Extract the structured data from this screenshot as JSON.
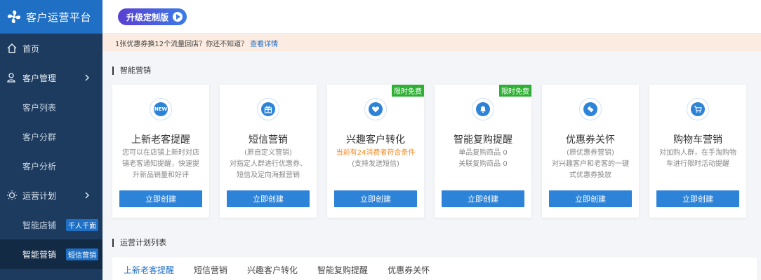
{
  "brand": {
    "title": "客户运营平台",
    "icon": "pinwheel-icon"
  },
  "sidebar": {
    "items": [
      {
        "label": "首页",
        "icon": "home-icon",
        "type": "top"
      },
      {
        "label": "客户管理",
        "icon": "user-icon",
        "type": "top",
        "chevron": true
      },
      {
        "label": "客户列表",
        "type": "sub"
      },
      {
        "label": "客户分群",
        "type": "sub"
      },
      {
        "label": "客户分析",
        "type": "sub"
      },
      {
        "label": "运营计划",
        "icon": "bulb-icon",
        "type": "top",
        "chevron": true
      },
      {
        "label": "智能店铺",
        "type": "sub",
        "tag": "千人千面"
      },
      {
        "label": "智能营销",
        "type": "sub",
        "tag": "短信营销",
        "active": true
      }
    ]
  },
  "topbar": {
    "upgrade_label": "升级定制版"
  },
  "notice": {
    "text": "1张优惠券换12个流量回店？你还不知道？",
    "link": "查看详情"
  },
  "sections": {
    "smart_marketing": "智能营销",
    "plan_list": "运营计划列表"
  },
  "cards": [
    {
      "title": "上新老客提醒",
      "icon": "new-icon",
      "icon_text": "NEW",
      "desc": [
        "您可以在店铺上新时对店",
        "铺老客通知提醒，快速提",
        "升新品销量和好评"
      ],
      "button": "立即创建"
    },
    {
      "title": "短信营销",
      "icon": "gift-icon",
      "desc": [
        "(原自定义营销)",
        "对指定人群进行优惠券、",
        "短信及定向海报营销"
      ],
      "button": "立即创建"
    },
    {
      "title": "兴趣客户转化",
      "icon": "heart-icon",
      "badge": "限时免费",
      "highlight": "当前有24消费者符合条件",
      "desc": [
        "(支持发送短信)"
      ],
      "button": "立即创建"
    },
    {
      "title": "智能复购提醒",
      "icon": "bell-icon",
      "badge": "限时免费",
      "desc": [
        "单品复购商品 0",
        "关联复购商品 0"
      ],
      "button": "立即创建"
    },
    {
      "title": "优惠券关怀",
      "icon": "ticket-icon",
      "desc": [
        "(原优惠券营销)",
        "对兴趣客户和老客的一键",
        "式优惠券投放"
      ],
      "button": "立即创建"
    },
    {
      "title": "购物车营销",
      "icon": "cart-icon",
      "desc": [
        "对加购人群，在手淘购物",
        "车进行限时活动提醒"
      ],
      "button": "立即创建"
    }
  ],
  "tabs": [
    {
      "label": "上新老客提醒",
      "active": true
    },
    {
      "label": "短信营销"
    },
    {
      "label": "兴趣客户转化"
    },
    {
      "label": "智能复购提醒"
    },
    {
      "label": "优惠券关怀"
    }
  ],
  "colors": {
    "sidebar_bg": "#1d3b5e",
    "brand_bg": "#1f6fc4",
    "primary": "#2d83d8",
    "badge_green": "#2fb034",
    "highlight_orange": "#f08a24"
  }
}
